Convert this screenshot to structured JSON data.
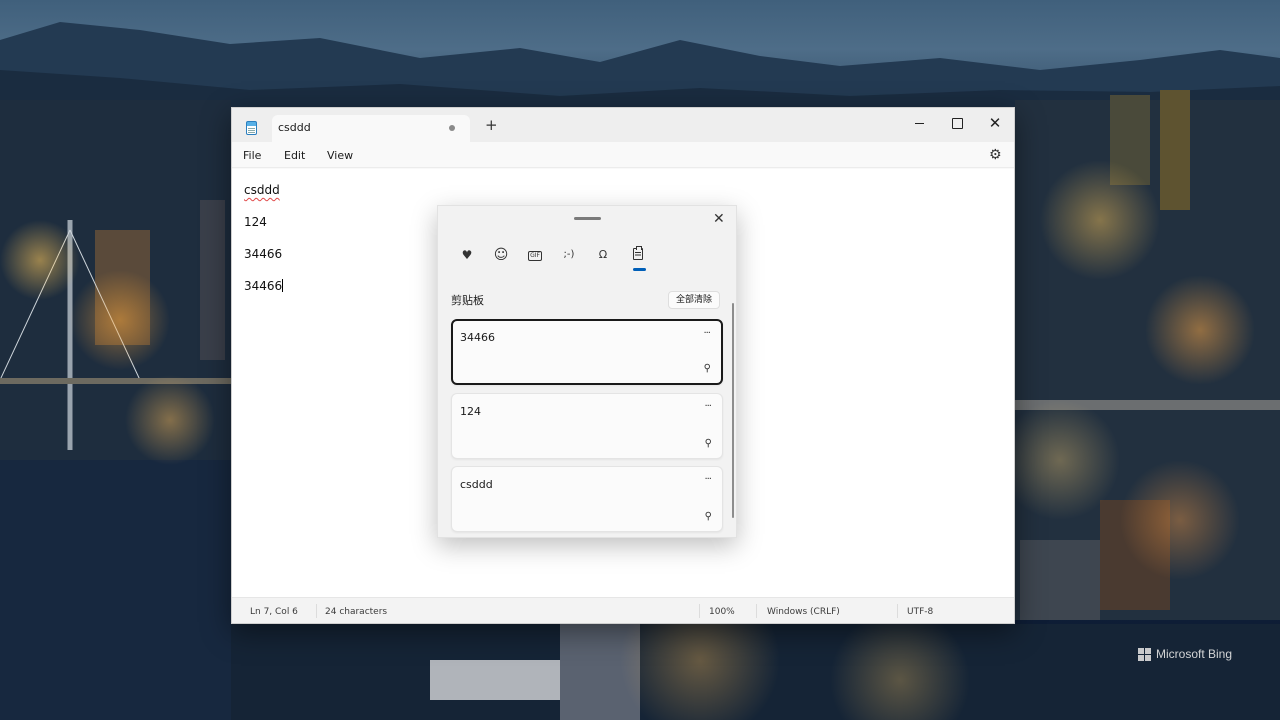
{
  "window": {
    "tab_title": "csddd",
    "new_tab_symbol": "+",
    "controls": {
      "close_symbol": "✕"
    }
  },
  "menu": [
    "File",
    "Edit",
    "View"
  ],
  "editor": {
    "lines": [
      "csddd",
      "124",
      "34466",
      "34466"
    ]
  },
  "status": {
    "position": "Ln 7, Col 6",
    "characters": "24 characters",
    "zoom": "100%",
    "line_ending": "Windows (CRLF)",
    "encoding": "UTF-8"
  },
  "clipboard_panel": {
    "close_symbol": "✕",
    "tabs": [
      {
        "icon": "heart-sticker-icon",
        "glyph": "♥"
      },
      {
        "icon": "emoji-icon",
        "glyph": "☺"
      },
      {
        "icon": "gif-icon",
        "glyph": "GIF"
      },
      {
        "icon": "kaomoji-icon",
        "glyph": ";-)"
      },
      {
        "icon": "symbols-icon",
        "glyph": "Ω"
      },
      {
        "icon": "clipboard-icon",
        "glyph": ""
      }
    ],
    "active_tab": "clipboard",
    "accent_color": "#005fb8",
    "title": "剪贴板",
    "clear_all_label": "全部清除",
    "items": [
      {
        "text": "34466",
        "selected": true
      },
      {
        "text": "124",
        "selected": false
      },
      {
        "text": "csddd",
        "selected": false
      }
    ],
    "more_symbol": "···",
    "pin_symbol": "⚲"
  },
  "watermark": "Microsoft Bing"
}
